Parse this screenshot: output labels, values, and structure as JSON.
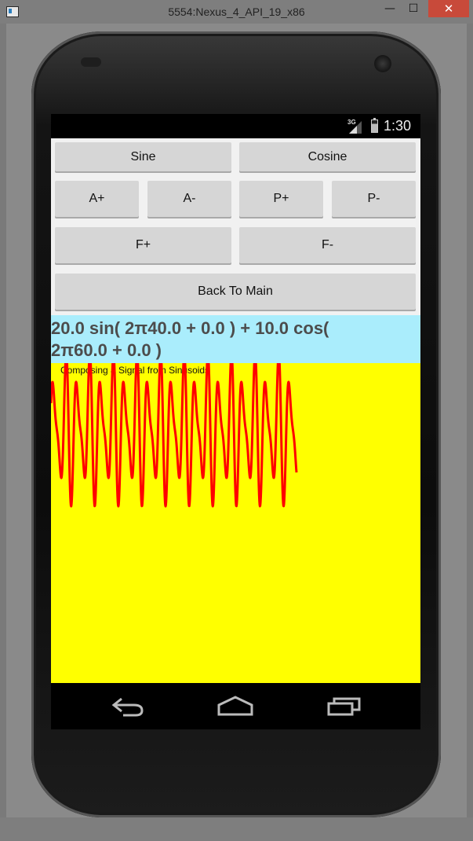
{
  "window": {
    "title": "5554:Nexus_4_API_19_x86",
    "minimize_glyph": "—",
    "maximize_glyph": "☐",
    "close_glyph": "✕"
  },
  "status_bar": {
    "network": "3G",
    "time": "1:30"
  },
  "buttons": {
    "sine": "Sine",
    "cosine": "Cosine",
    "amp_up": "A+",
    "amp_down": "A-",
    "phase_up": "P+",
    "phase_down": "P-",
    "freq_up": "F+",
    "freq_down": "F-",
    "back": "Back To Main"
  },
  "formula": {
    "line1": "20.0 sin( 2π40.0 + 0.0 ) + 10.0 cos(",
    "line2": "2π60.0 + 0.0 )"
  },
  "plot": {
    "title": "Composing a Signal from Sinusoids",
    "background": "#ffff00",
    "line_color": "#ff0000"
  },
  "chart_data": {
    "type": "line",
    "title": "Composing a Signal from Sinusoids",
    "expression": "20.0 sin(2π·40·t) + 10.0 cos(2π·60·t)",
    "components": [
      {
        "function": "sin",
        "amplitude": 20.0,
        "frequency": 40.0,
        "phase": 0.0
      },
      {
        "function": "cos",
        "amplitude": 10.0,
        "frequency": 60.0,
        "phase": 0.0
      }
    ],
    "cycles_shown": 10.4
  },
  "navbar": {
    "icons": [
      "back-icon",
      "home-icon",
      "recent-apps-icon"
    ]
  }
}
